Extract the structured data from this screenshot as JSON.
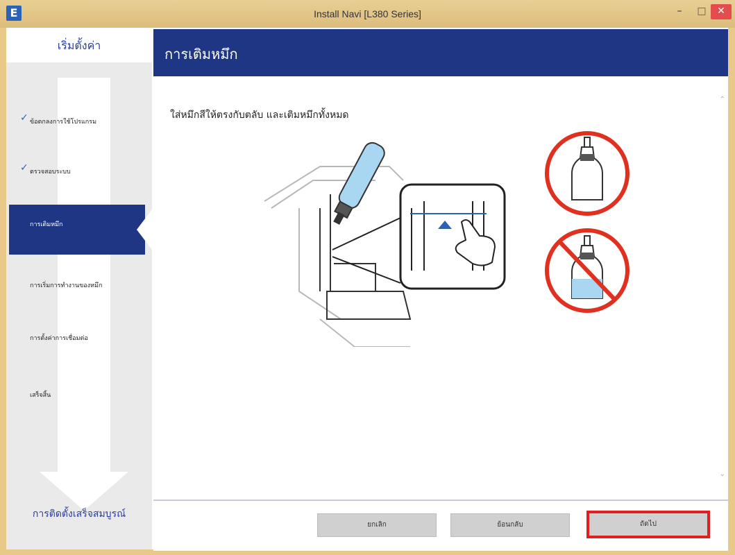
{
  "window": {
    "title": "Install Navi [L380 Series]",
    "app_icon": "E"
  },
  "sidebar": {
    "header": "เริ่มตั้งค่า",
    "steps": [
      {
        "label": "ข้อตกลงการใช้โปรแกรม",
        "done": true
      },
      {
        "label": "ตรวจสอบระบบ",
        "done": true
      },
      {
        "label": "การเติมหมึก",
        "active": true
      },
      {
        "label": "การเริ่มการทำงานของหมึก"
      },
      {
        "label": "การตั้งค่าการเชื่อมต่อ"
      },
      {
        "label": "เสร็จสิ้น"
      }
    ],
    "footer": "การติดตั้งเสร็จสมบูรณ์"
  },
  "header": {
    "title": "การเติมหมึก"
  },
  "content": {
    "instruction": "ใส่หมึกสีให้ตรงกับตลับ และเติมหมึกทั้งหมด"
  },
  "buttons": {
    "cancel": "ยกเลิก",
    "back": "ย้อนกลับ",
    "next": "ถัดไป"
  },
  "colors": {
    "accent": "#1f3685",
    "highlight": "#e02020",
    "ink": "#a9d6f0"
  }
}
